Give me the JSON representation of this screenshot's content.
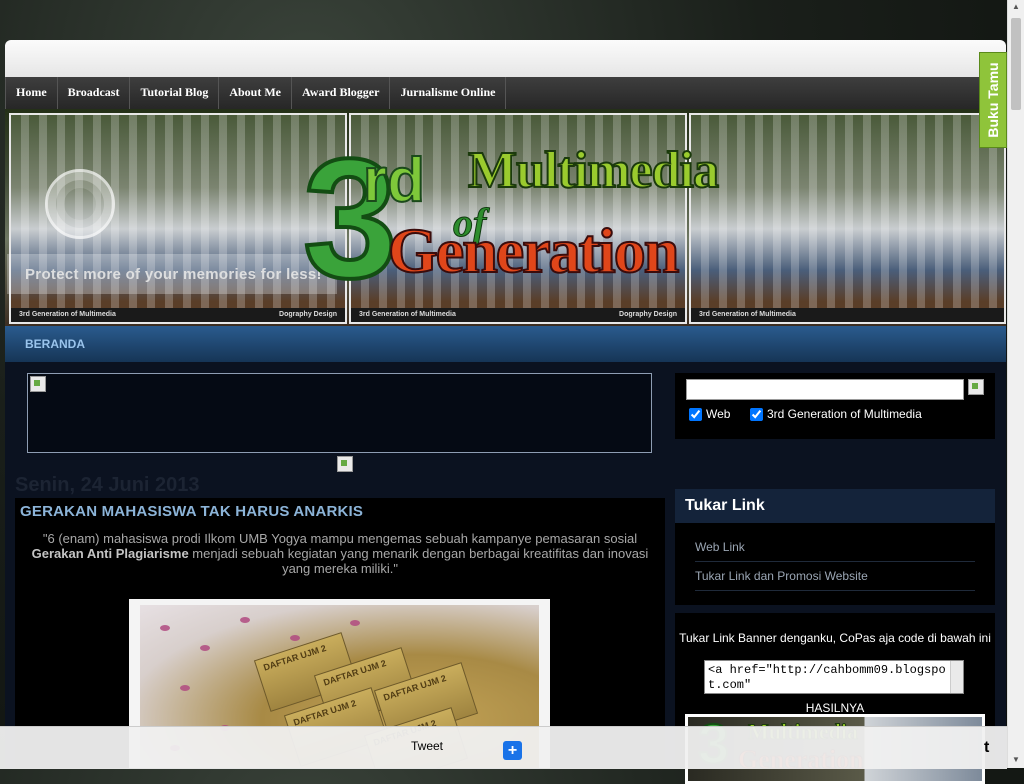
{
  "nav": {
    "items": [
      {
        "label": "Home"
      },
      {
        "label": "Broadcast"
      },
      {
        "label": "Tutorial Blog"
      },
      {
        "label": "About Me"
      },
      {
        "label": "Award Blogger"
      },
      {
        "label": "Jurnalisme Online"
      }
    ]
  },
  "header": {
    "logo_number": "3",
    "logo_rd": "rd",
    "logo_of": "of",
    "logo_multimedia": "Multimedia",
    "logo_generation": "Generation",
    "tagline": "Protect more of your memories for less!",
    "frame_caption_left": "3rd Generation of Multimedia",
    "frame_caption_right": "Dography Design"
  },
  "subnav": {
    "label": "BERANDA"
  },
  "main": {
    "date": "Senin, 24 Juni 2013",
    "post": {
      "title": "GERAKAN MAHASISWA TAK HARUS ANARKIS",
      "quote_start": "\"6 (enam)  mahasiswa prodi Ilkom UMB Yogya mampu mengemas sebuah kampanye pemasaran sosial ",
      "quote_bold": "Gerakan Anti Plagiarisme",
      "quote_end": " menjadi sebuah kegiatan yang menarik dengan berbagai kreatifitas dan inovasi yang mereka miliki.\"",
      "ticket_label": "DAFTAR UJM 2"
    }
  },
  "sidebar": {
    "search": {
      "value": "",
      "option_web": "Web",
      "option_site": "3rd Generation of Multimedia"
    },
    "tukar_link": {
      "title": "Tukar Link",
      "links": [
        {
          "label": "Web Link"
        },
        {
          "label": "Tukar Link dan Promosi Website"
        }
      ]
    },
    "banner_widget": {
      "text": "Tukar Link Banner denganku, CoPas aja code di bawah ini",
      "code": "<a href=\"http://cahbomm09.blogspot.com\"",
      "result_label": "HASILNYA"
    }
  },
  "buku_tamu": {
    "label": "Buku Tamu"
  },
  "share_bar": {
    "tweet_label": "Tweet",
    "plus_label": "+",
    "t_label": "t"
  },
  "scrollbar": {
    "up": "▲",
    "down": "▼"
  },
  "colors": {
    "nav_bg": "#333333",
    "subnav_bg": "#1d4470",
    "post_title": "#8cb4d8",
    "buku_tamu_bg": "#8fc43a",
    "share_plus": "#1a73e8"
  }
}
